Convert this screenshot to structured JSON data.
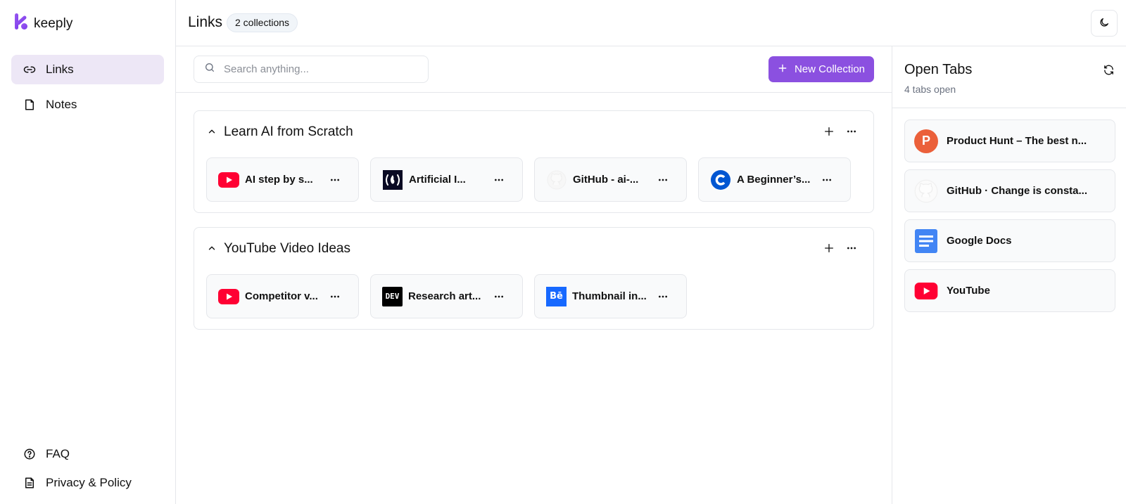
{
  "brand": {
    "name": "keeply",
    "accent": "#8b50e0"
  },
  "sidebar": {
    "items": [
      {
        "label": "Links",
        "icon": "link-icon",
        "active": true
      },
      {
        "label": "Notes",
        "icon": "file-icon",
        "active": false
      }
    ],
    "footer": [
      {
        "label": "FAQ",
        "icon": "help-circle-icon"
      },
      {
        "label": "Privacy & Policy",
        "icon": "document-icon"
      }
    ]
  },
  "header": {
    "title": "Links",
    "badge": "2 collections",
    "theme_toggle_icon": "moon-icon"
  },
  "toolbar": {
    "search_placeholder": "Search anything...",
    "new_collection_label": "New Collection"
  },
  "collections": [
    {
      "title": "Learn AI from Scratch",
      "links": [
        {
          "title": "AI step by s...",
          "icon": "youtube-icon"
        },
        {
          "title": "Artificial I...",
          "icon": "freecodecamp-icon"
        },
        {
          "title": "GitHub - ai-...",
          "icon": "github-icon"
        },
        {
          "title": "A Beginner’s...",
          "icon": "coursera-icon"
        }
      ]
    },
    {
      "title": "YouTube Video Ideas",
      "links": [
        {
          "title": "Competitor v...",
          "icon": "youtube-icon"
        },
        {
          "title": "Research art...",
          "icon": "dev-icon",
          "icon_text": "DEV"
        },
        {
          "title": "Thumbnail in...",
          "icon": "behance-icon",
          "icon_text": "Bē"
        }
      ]
    }
  ],
  "open_tabs": {
    "title": "Open Tabs",
    "subtitle": "4 tabs open",
    "tabs": [
      {
        "label": "Product Hunt – The best n...",
        "icon": "product-hunt-icon",
        "icon_text": "P"
      },
      {
        "label": "GitHub · Change is consta...",
        "icon": "github-icon"
      },
      {
        "label": "Google Docs",
        "icon": "google-docs-icon"
      },
      {
        "label": "YouTube",
        "icon": "youtube-icon"
      }
    ]
  }
}
